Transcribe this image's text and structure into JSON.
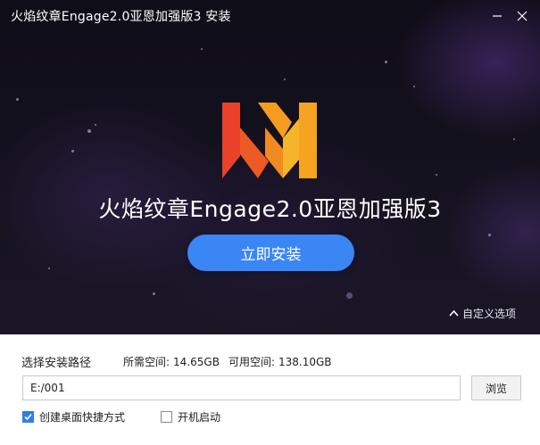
{
  "window": {
    "title": "火焰纹章Engage2.0亚恩加强版3 安装"
  },
  "hero": {
    "app_name": "火焰纹章Engage2.0亚恩加强版3",
    "install_label": "立即安装",
    "custom_options_label": "自定义选项"
  },
  "options": {
    "path_label": "选择安装路径",
    "required_space_label": "所需空间:",
    "required_space_value": "14.65GB",
    "available_space_label": "可用空间:",
    "available_space_value": "138.10GB",
    "path_value": "E:/001",
    "browse_label": "浏览",
    "desktop_shortcut": {
      "label": "创建桌面快捷方式",
      "checked": true
    },
    "boot_start": {
      "label": "开机启动",
      "checked": false
    }
  },
  "icons": {
    "minimize": "minimize-icon",
    "close": "close-icon",
    "logo": "app-logo",
    "chevron": "chevron-up-icon",
    "check": "checkmark-icon"
  },
  "colors": {
    "accent": "#3a86f5",
    "hero_bg": "#15121f",
    "logo_red": "#e8432a",
    "logo_orange": "#f6a321"
  }
}
